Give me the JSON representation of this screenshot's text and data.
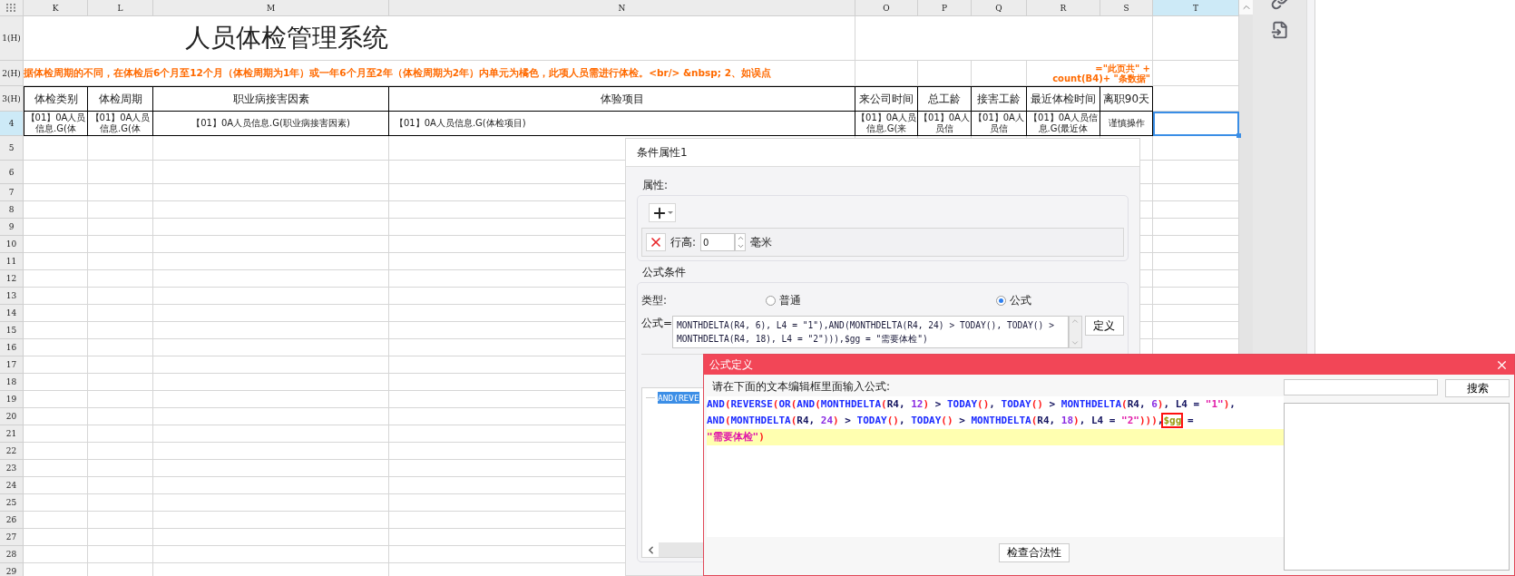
{
  "sheet": {
    "columns": [
      {
        "label": "K",
        "selected": false
      },
      {
        "label": "L",
        "selected": false
      },
      {
        "label": "M",
        "selected": false
      },
      {
        "label": "N",
        "selected": false
      },
      {
        "label": "O",
        "selected": false
      },
      {
        "label": "P",
        "selected": false
      },
      {
        "label": "Q",
        "selected": false
      },
      {
        "label": "R",
        "selected": false
      },
      {
        "label": "S",
        "selected": false
      },
      {
        "label": "T",
        "selected": true
      }
    ],
    "rows": [
      {
        "label": "1(H)",
        "selected": false
      },
      {
        "label": "2(H)",
        "selected": false
      },
      {
        "label": "3(H)",
        "selected": false
      },
      {
        "label": "4",
        "selected": true
      },
      {
        "label": "5",
        "selected": false
      },
      {
        "label": "6",
        "selected": false
      },
      {
        "label": "7",
        "selected": false
      },
      {
        "label": "8",
        "selected": false
      },
      {
        "label": "9",
        "selected": false
      },
      {
        "label": "10",
        "selected": false
      },
      {
        "label": "11",
        "selected": false
      },
      {
        "label": "12",
        "selected": false
      },
      {
        "label": "13",
        "selected": false
      },
      {
        "label": "14",
        "selected": false
      },
      {
        "label": "15",
        "selected": false
      },
      {
        "label": "16",
        "selected": false
      },
      {
        "label": "17",
        "selected": false
      },
      {
        "label": "18",
        "selected": false
      },
      {
        "label": "19",
        "selected": false
      },
      {
        "label": "20",
        "selected": false
      },
      {
        "label": "21",
        "selected": false
      },
      {
        "label": "22",
        "selected": false
      },
      {
        "label": "23",
        "selected": false
      },
      {
        "label": "24",
        "selected": false
      },
      {
        "label": "25",
        "selected": false
      },
      {
        "label": "26",
        "selected": false
      },
      {
        "label": "27",
        "selected": false
      },
      {
        "label": "28",
        "selected": false
      },
      {
        "label": "29",
        "selected": false
      }
    ],
    "title": "人员体检管理系统",
    "note": "据体检周期的不同，在体检后6个月至12个月（体检周期为1年）或一年6个月至2年（体检周期为2年）内单元为橘色，此项人员需进行体检。<br/> &nbsp; 2、如误点",
    "count_formula": [
      "=\"此页共\" +",
      "count(B4)+ \"条数据\""
    ],
    "headers": [
      "体检类别",
      "体检周期",
      "职业病接害因素",
      "体验项目",
      "来公司时间",
      "总工龄",
      "接害工龄",
      "最近体检时间",
      "离职90天"
    ],
    "data_row": [
      "【01】0A人员信息.G(体",
      "【01】0A人员信息.G(体",
      "【01】0A人员信息.G(职业病接害因素)",
      "【01】0A人员信息.G(体检项目)",
      "【01】0A人员信息.G(来",
      "【01】0A人员信",
      "【01】0A人员信",
      "【01】0A人员信息.G(最近体",
      "谨慎操作"
    ]
  },
  "condition_panel": {
    "title": "条件属性1",
    "property_group": {
      "label": "属性:",
      "row_height_label": "行高:",
      "row_height_value": "0",
      "unit": "毫米"
    },
    "formula_condition": {
      "label": "公式条件",
      "type_label": "类型:",
      "type_options": [
        {
          "label": "普通",
          "selected": false
        },
        {
          "label": "公式",
          "selected": true
        }
      ],
      "formula_label": "公式=",
      "formula_lines": [
        "MONTHDELTA(R4, 6), L4 = \"1\"),AND(MONTHDELTA(R4, 24) > TODAY(), TODAY() >",
        "MONTHDELTA(R4, 18), L4 = \"2\"))),$gg = \"需要体检\")"
      ],
      "define_button": "定义",
      "preview_selection": "AND(REVE"
    }
  },
  "formula_dialog": {
    "title": "公式定义",
    "prompt": "请在下面的文本编辑框里面输入公式:",
    "lines": [
      {
        "current": false,
        "tokens": [
          {
            "t": "AND",
            "kind": "fn"
          },
          {
            "t": "(",
            "kind": "paren"
          },
          {
            "t": "REVERSE",
            "kind": "fn"
          },
          {
            "t": "(",
            "kind": "paren"
          },
          {
            "t": "OR",
            "kind": "fn"
          },
          {
            "t": "(",
            "kind": "paren"
          },
          {
            "t": "AND",
            "kind": "fn"
          },
          {
            "t": "(",
            "kind": "paren"
          },
          {
            "t": "MONTHDELTA",
            "kind": "fn"
          },
          {
            "t": "(",
            "kind": "paren"
          },
          {
            "t": "R4, ",
            "kind": "plain"
          },
          {
            "t": "12",
            "kind": "num"
          },
          {
            "t": ")",
            "kind": "paren"
          },
          {
            "t": " > ",
            "kind": "plain"
          },
          {
            "t": "TODAY",
            "kind": "fn"
          },
          {
            "t": "()",
            "kind": "paren"
          },
          {
            "t": ", ",
            "kind": "plain"
          },
          {
            "t": "TODAY",
            "kind": "fn"
          },
          {
            "t": "()",
            "kind": "paren"
          },
          {
            "t": " > ",
            "kind": "plain"
          },
          {
            "t": "MONTHDELTA",
            "kind": "fn"
          },
          {
            "t": "(",
            "kind": "paren"
          },
          {
            "t": "R4, ",
            "kind": "plain"
          },
          {
            "t": "6",
            "kind": "num"
          },
          {
            "t": ")",
            "kind": "paren"
          },
          {
            "t": ", L4 = ",
            "kind": "plain"
          },
          {
            "t": "\"1\"",
            "kind": "str"
          },
          {
            "t": ")",
            "kind": "paren"
          },
          {
            "t": ",",
            "kind": "plain"
          }
        ]
      },
      {
        "current": false,
        "tokens": [
          {
            "t": "AND",
            "kind": "fn"
          },
          {
            "t": "(",
            "kind": "paren"
          },
          {
            "t": "MONTHDELTA",
            "kind": "fn"
          },
          {
            "t": "(",
            "kind": "paren"
          },
          {
            "t": "R4, ",
            "kind": "plain"
          },
          {
            "t": "24",
            "kind": "num"
          },
          {
            "t": ")",
            "kind": "paren"
          },
          {
            "t": " > ",
            "kind": "plain"
          },
          {
            "t": "TODAY",
            "kind": "fn"
          },
          {
            "t": "()",
            "kind": "paren"
          },
          {
            "t": ", ",
            "kind": "plain"
          },
          {
            "t": "TODAY",
            "kind": "fn"
          },
          {
            "t": "()",
            "kind": "paren"
          },
          {
            "t": " > ",
            "kind": "plain"
          },
          {
            "t": "MONTHDELTA",
            "kind": "fn"
          },
          {
            "t": "(",
            "kind": "paren"
          },
          {
            "t": "R4, ",
            "kind": "plain"
          },
          {
            "t": "18",
            "kind": "num"
          },
          {
            "t": ")",
            "kind": "paren"
          },
          {
            "t": ", L4 = ",
            "kind": "plain"
          },
          {
            "t": "\"2\"",
            "kind": "str"
          },
          {
            "t": ")))",
            "kind": "paren"
          },
          {
            "t": ",",
            "kind": "plain"
          },
          {
            "t": "$gg",
            "kind": "var",
            "boxed": true
          },
          {
            "t": " =",
            "kind": "plain"
          }
        ]
      },
      {
        "current": true,
        "tokens": [
          {
            "t": "\"需要体检\"",
            "kind": "str"
          },
          {
            "t": ")",
            "kind": "paren"
          }
        ]
      }
    ],
    "check_button": "检查合法性",
    "search_button": "搜索"
  }
}
